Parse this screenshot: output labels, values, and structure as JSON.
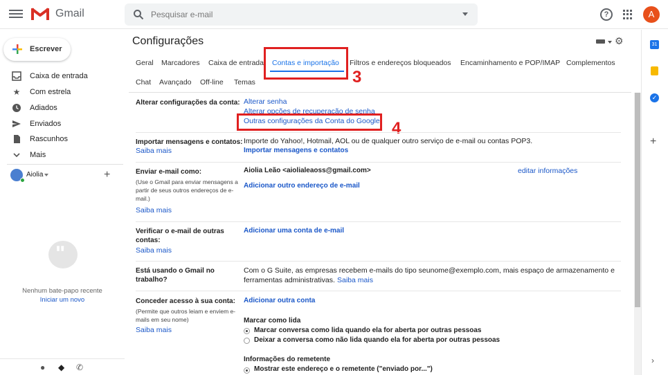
{
  "header": {
    "app_name": "Gmail",
    "search_placeholder": "Pesquisar e-mail",
    "avatar_letter": "A"
  },
  "sidebar": {
    "compose_label": "Escrever",
    "items": [
      {
        "label": "Caixa de entrada",
        "icon": "inbox-icon"
      },
      {
        "label": "Com estrela",
        "icon": "star-icon"
      },
      {
        "label": "Adiados",
        "icon": "clock-icon"
      },
      {
        "label": "Enviados",
        "icon": "send-icon"
      },
      {
        "label": "Rascunhos",
        "icon": "draft-icon"
      },
      {
        "label": "Mais",
        "icon": "chevron-down-icon"
      }
    ],
    "user_name": "Aiolia",
    "chat_empty": "Nenhum bate-papo recente",
    "chat_start": "Iniciar um novo"
  },
  "settings": {
    "title": "Configurações",
    "tabs_row1": [
      "Geral",
      "Marcadores",
      "Caixa de entrada",
      "Contas e importação",
      "Filtros e endereços bloqueados",
      "Encaminhamento e POP/IMAP",
      "Complementos"
    ],
    "tabs_row2": [
      "Chat",
      "Avançado",
      "Off-line",
      "Temas"
    ],
    "sections": {
      "change_account": {
        "label": "Alterar configurações da conta:",
        "links": [
          "Alterar senha",
          "Alterar opções de recuperação de senha",
          "Outras configurações da Conta do Google"
        ]
      },
      "import": {
        "label": "Importar mensagens e contatos:",
        "learn_more": "Saiba mais",
        "text": "Importe do Yahoo!, Hotmail, AOL ou de qualquer outro serviço de e-mail ou contas POP3.",
        "action": "Importar mensagens e contatos"
      },
      "send_as": {
        "label": "Enviar e-mail como:",
        "note": "(Use o Gmail para enviar mensagens a partir de seus outros endereços de e-mail.)",
        "learn_more": "Saiba mais",
        "address": "Aiolia Leão <aiolialeaoss@gmail.com>",
        "edit": "editar informações",
        "add": "Adicionar outro endereço de e-mail"
      },
      "check_mail": {
        "label": "Verificar o e-mail de outras contas:",
        "learn_more": "Saiba mais",
        "add": "Adicionar uma conta de e-mail"
      },
      "work": {
        "label": "Está usando o Gmail no trabalho?",
        "text1": "Com o G Suite, as empresas recebem e-mails do tipo seunome@exemplo.com, mais espaço de armazenamento e",
        "text2": "ferramentas administrativas.",
        "learn_more": "Saiba mais"
      },
      "grant": {
        "label": "Conceder acesso à sua conta:",
        "note": "(Permite que outros leiam e enviem e-mails em seu nome)",
        "learn_more": "Saiba mais",
        "add": "Adicionar outra conta",
        "mark_read_title": "Marcar como lida",
        "opt1": "Marcar conversa como lida quando ela for aberta por outras pessoas",
        "opt2": "Deixar a conversa como não lida quando ela for aberta por outras pessoas",
        "sender_title": "Informações do remetente",
        "opt3": "Mostrar este endereço e o remetente (\"enviado por...\")"
      }
    }
  },
  "annotations": {
    "step3": "3",
    "step4": "4"
  },
  "colors": {
    "accent": "#1a73e8",
    "annotation": "#e02020",
    "avatar": "#e8501b"
  }
}
